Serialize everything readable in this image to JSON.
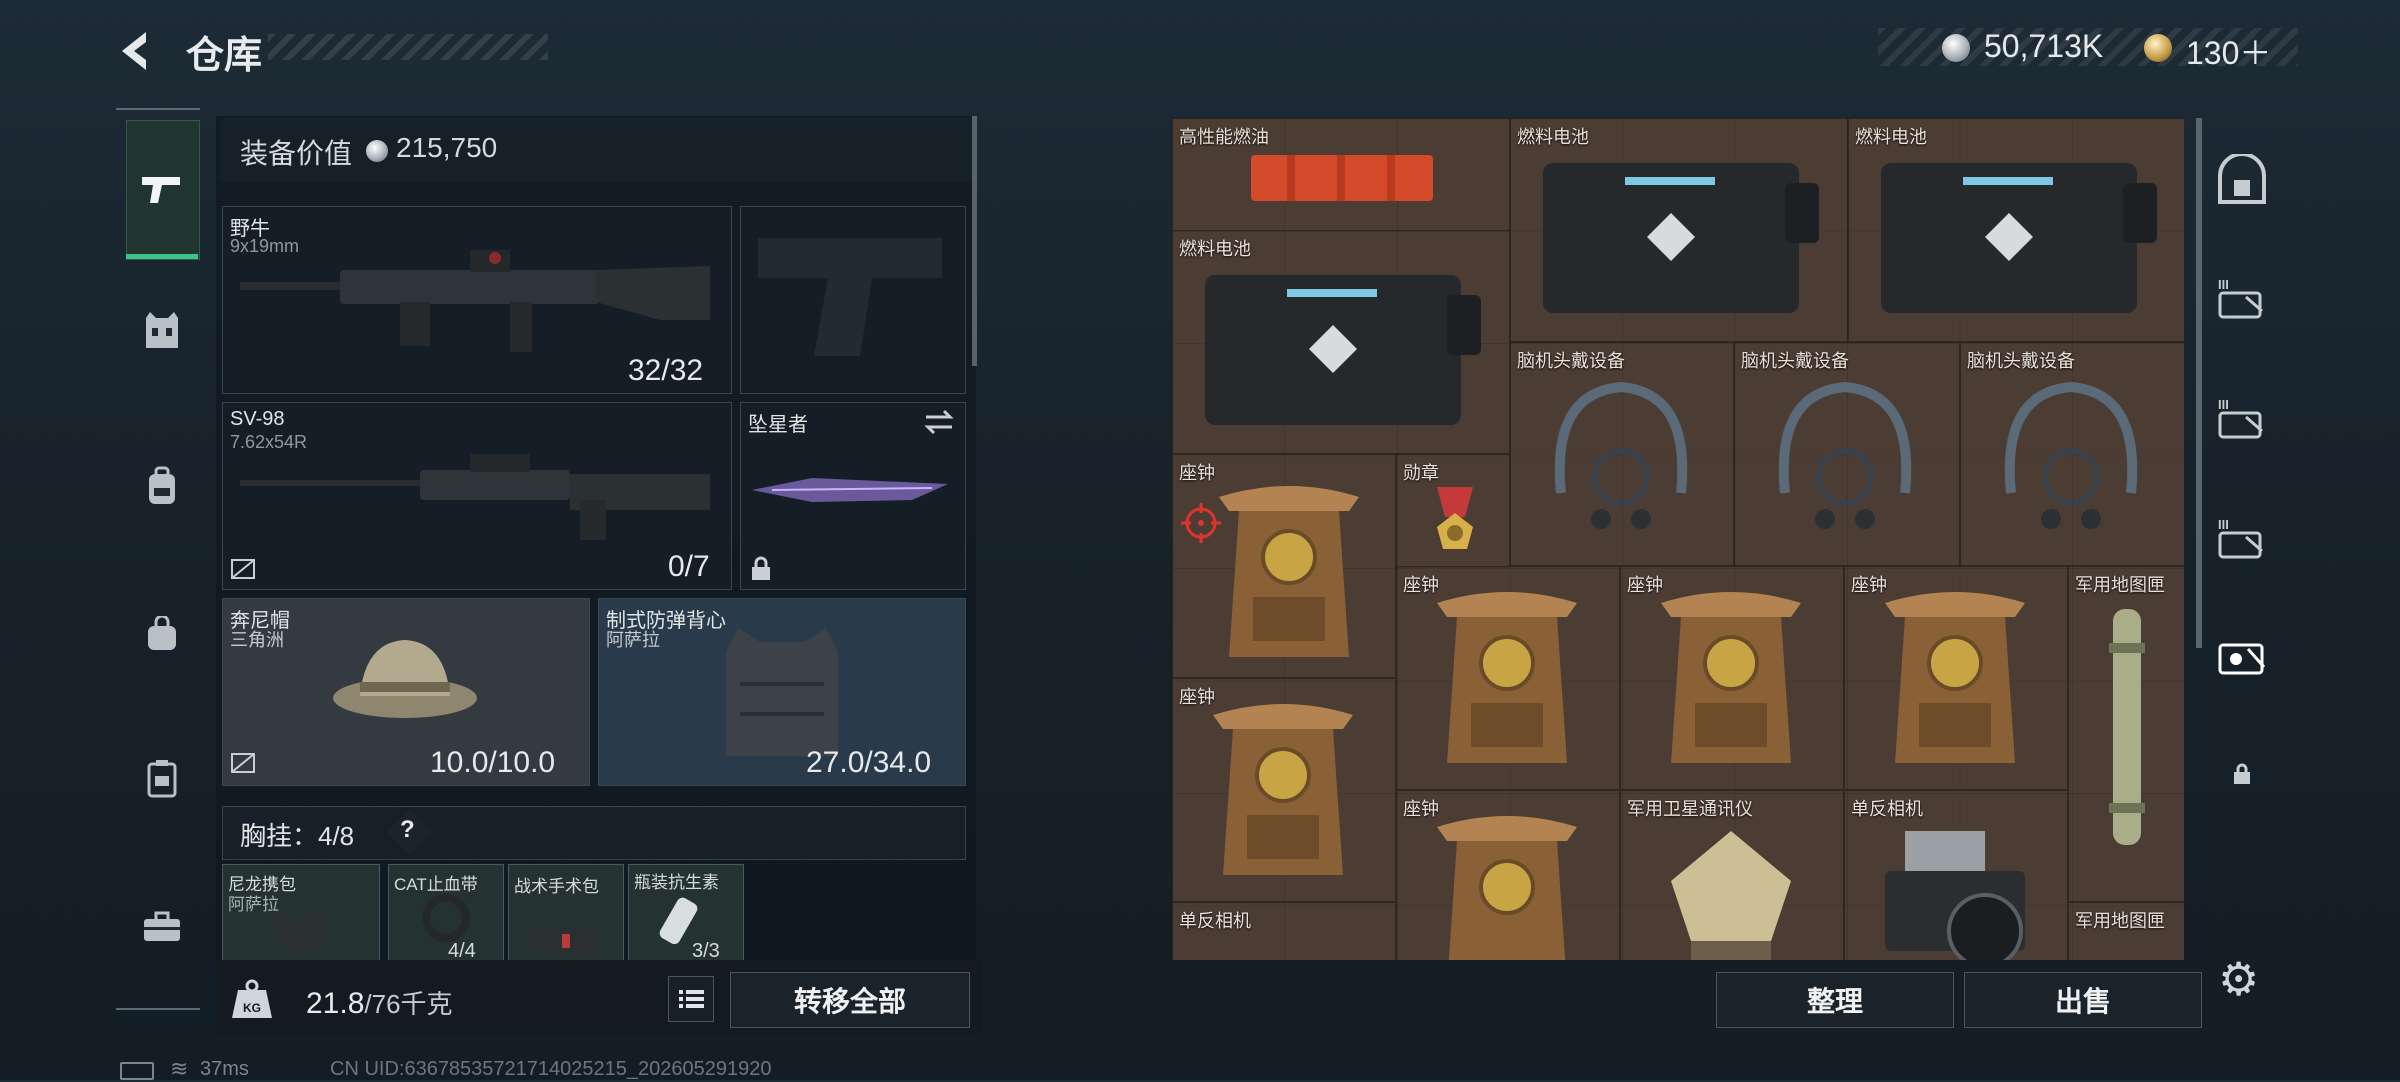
{
  "header": {
    "title": "仓库",
    "currency": [
      {
        "icon": "silver-coin-icon",
        "value": "50,713K"
      },
      {
        "icon": "gold-coin-icon",
        "value": "130＋"
      }
    ]
  },
  "left_rail": {
    "items": [
      "pistol-icon",
      "armor-vest-icon",
      "backpack-icon",
      "bag-icon",
      "locker-icon",
      "toolbox-icon"
    ],
    "active": "pistol-icon"
  },
  "equipment": {
    "value_label": "装备价值",
    "value": "215,750",
    "slots": {
      "primary": {
        "name": "野牛",
        "caliber": "9x19mm",
        "ammo": "32/32"
      },
      "secondary": {
        "name": "SV-98",
        "caliber": "7.62x54R",
        "ammo": "0/7"
      },
      "melee": {
        "name": "坠星者"
      },
      "helmet": {
        "name": "奔尼帽",
        "sub": "三角洲",
        "durability": "10.0/10.0"
      },
      "armor": {
        "name": "制式防弹背心",
        "sub": "阿萨拉",
        "durability": "27.0/34.0"
      }
    },
    "chest_rig": {
      "label": "胸挂：4/8",
      "help": "?"
    },
    "pouches": [
      {
        "name": "尼龙携包",
        "sub": "阿萨拉",
        "count": ""
      },
      {
        "name": "CAT止血带",
        "sub": "",
        "count": "4/4"
      },
      {
        "name": "战术手术包",
        "sub": "",
        "count": ""
      },
      {
        "name": "瓶装抗生素",
        "sub": "",
        "count": "3/3"
      }
    ],
    "weight": {
      "current": "21.8",
      "max": "/76千克"
    },
    "transfer_all": "转移全部"
  },
  "container": {
    "items": [
      {
        "name": "高性能燃油"
      },
      {
        "name": "燃料电池"
      },
      {
        "name": "燃料电池"
      },
      {
        "name": "燃料电池"
      },
      {
        "name": "脑机头戴设备"
      },
      {
        "name": "脑机头戴设备"
      },
      {
        "name": "脑机头戴设备"
      },
      {
        "name": "座钟"
      },
      {
        "name": "勋章"
      },
      {
        "name": "座钟"
      },
      {
        "name": "座钟"
      },
      {
        "name": "座钟"
      },
      {
        "name": "军用地图匣"
      },
      {
        "name": "座钟"
      },
      {
        "name": "座钟"
      },
      {
        "name": "军用卫星通讯仪"
      },
      {
        "name": "单反相机"
      },
      {
        "name": "单反相机"
      },
      {
        "name": "军用地图匣"
      }
    ],
    "sort_button": "整理",
    "sell_button": "出售"
  },
  "right_rail": {
    "items": [
      "safe-box-icon",
      "case-tier3-icon",
      "case-tier3-icon",
      "case-tier3-icon",
      "case-selected-icon",
      "lock-icon"
    ]
  },
  "status_bar": {
    "ping": "37ms",
    "uid": "CN UID:6367853572171402521​5_202605291920"
  }
}
